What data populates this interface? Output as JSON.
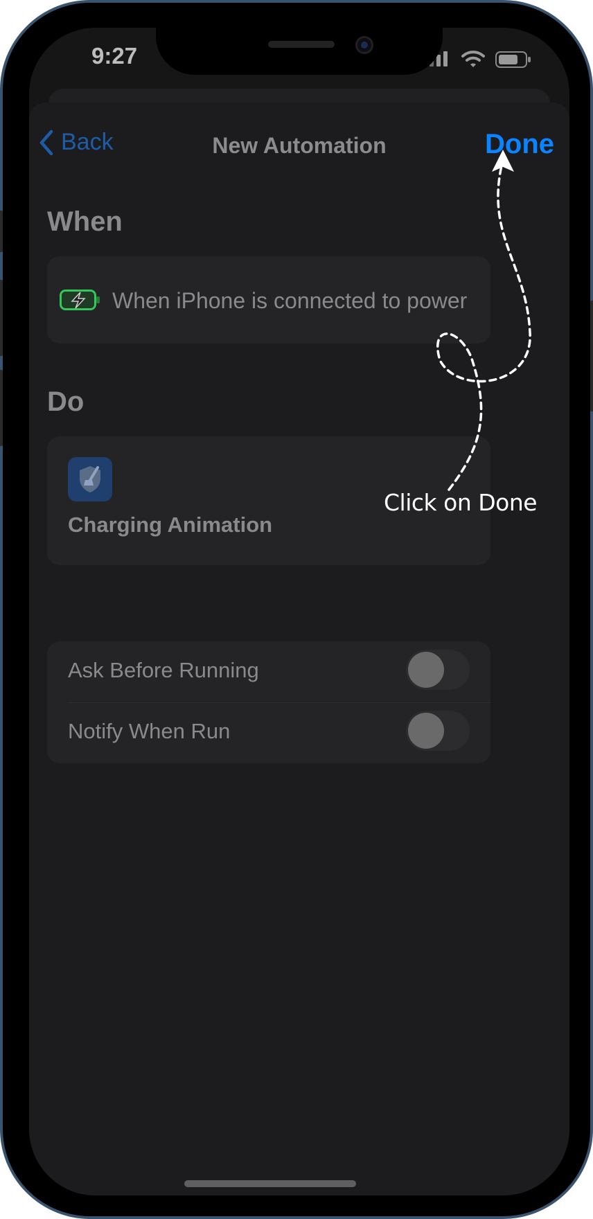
{
  "status_bar": {
    "time": "9:27"
  },
  "nav": {
    "back_label": "Back",
    "title": "New Automation",
    "done_label": "Done"
  },
  "when_section": {
    "heading": "When",
    "trigger_text": "When iPhone is connected to power"
  },
  "do_section": {
    "heading": "Do",
    "action_name": "Charging Animation"
  },
  "settings": [
    {
      "label": "Ask Before Running",
      "enabled": false
    },
    {
      "label": "Notify When Run",
      "enabled": false
    }
  ],
  "annotation": {
    "text": "Click on Done"
  },
  "colors": {
    "accent": "#0a84ff",
    "dimmed_text": "#8a8a8c",
    "card_bg": "#242426",
    "sheet_bg": "#1c1c1e",
    "charging_green": "#34c759"
  },
  "icons": [
    "chevron-left-icon",
    "signal-icon",
    "wifi-icon",
    "battery-icon",
    "charging-battery-icon",
    "cleaner-shield-icon"
  ]
}
